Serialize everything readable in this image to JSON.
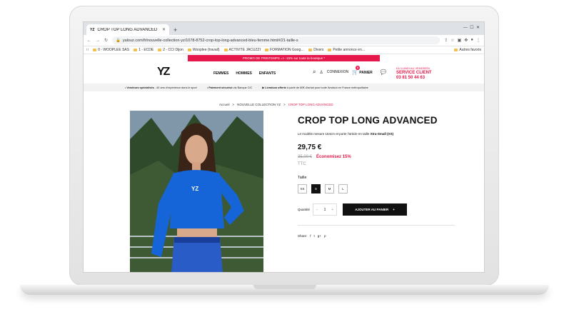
{
  "browser": {
    "tab_title": "CROP TOP LONG ADVANCED",
    "tab_icon_text": "YZ",
    "url": "yalouz.com/fr/nouvelle-collection-yz/1078-8752-crop-top-long-advanced-bleu-femme.html#/21-taille-s",
    "bookmarks": [
      "0 - WOOPLEE SAS",
      "1 - ECDE",
      "2 - CCI Dijon",
      "Wooplee (travail)",
      "ACTIVITE JACUZZI",
      "FORMATION Goog…",
      "Divers",
      "Petite annonce en…"
    ],
    "other_bookmarks": "Autres favoris"
  },
  "site": {
    "promo": "PROMO DE PRINTEMPS => -15% sur toute la boutique *",
    "logo": "YZ",
    "nav": [
      "FEMMES",
      "HOMMES",
      "ENFANTS"
    ],
    "login": "CONNEXION",
    "cart_label": "PANIER",
    "cart_count": "0",
    "service_line1": "DU LUNDI AU VENDREDI",
    "service_line2": "SERVICE CLIENT",
    "service_phone": "03 81 50 44 63",
    "info": {
      "a_bold": "Vendeurs spécialisés",
      "a_text": " - 40 ans d'expérience dans le sport",
      "b_bold": "Paiement sécurisé",
      "b_text": " via Banque CIC",
      "c_bold": "Livraison offerte",
      "c_text": " à partir de 80€ d'achat pour toute livraison en France métropolitaine"
    },
    "breadcrumb": {
      "home": "Accueil",
      "sep": ">",
      "collection": "NOUVELLE COLLECTION YZ",
      "current": "CROP TOP LONG ADVANCED"
    }
  },
  "product": {
    "title": "CROP TOP LONG ADVANCED",
    "desc_prefix": "Le modèle mesure 164cm et porte l'article en taille ",
    "desc_size": "Xtra-Small (XS)",
    "price": "29,75 €",
    "old_price": "35,00 €",
    "saving": "Économisez 15%",
    "ttc": "TTC",
    "size_label": "Taille",
    "sizes": [
      "XS",
      "S",
      "M",
      "L"
    ],
    "selected_size": "S",
    "quantity_label": "Quantité",
    "quantity": "1",
    "qty_minus": "−",
    "qty_plus": "+",
    "add_to_cart": "AJOUTER AU PANIER",
    "add_icon": "+",
    "share_label": "Share:",
    "share_icons": [
      "f",
      "t",
      "g+",
      "p"
    ]
  },
  "colors": {
    "accent": "#e5174b",
    "dark": "#111111",
    "top_blue": "#1565d8"
  }
}
